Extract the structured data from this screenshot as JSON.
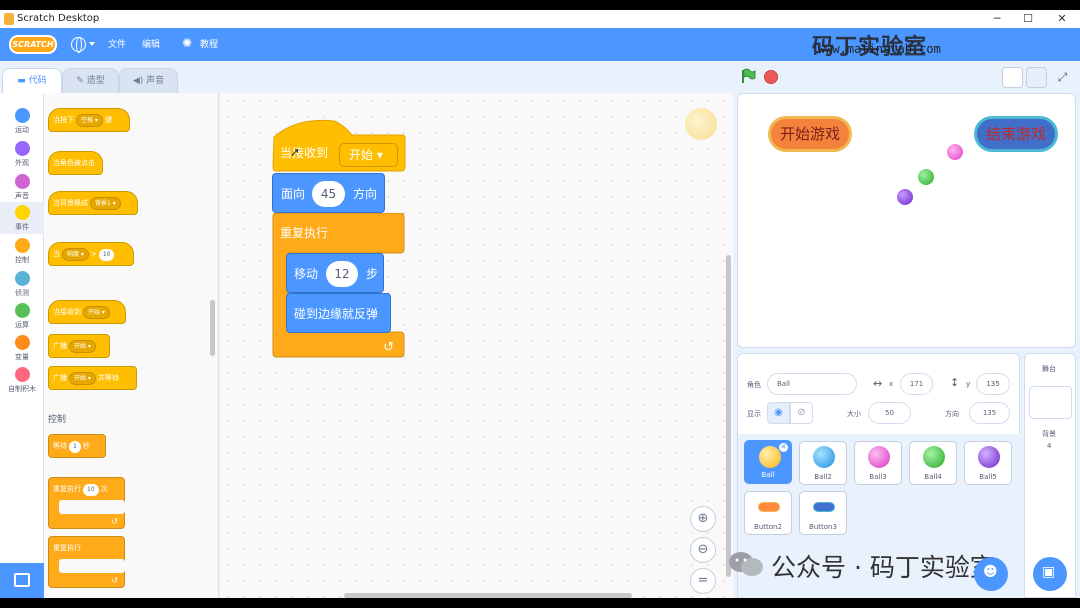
{
  "window": {
    "title": "Scratch Desktop",
    "min": "─",
    "max": "☐",
    "close": "✕"
  },
  "menubar": {
    "logo": "SCRATCH",
    "file": "文件",
    "edit": "编辑",
    "tutorials": "教程"
  },
  "watermark": {
    "title": "码丁实验室",
    "url": "www.matinslab.com",
    "wechat": "公众号 · 码丁实验室"
  },
  "tabs": {
    "code": "代码",
    "costumes": "造型",
    "sounds": "声音"
  },
  "categories": [
    {
      "label": "运动",
      "color": "#4c97ff"
    },
    {
      "label": "外观",
      "color": "#9966ff"
    },
    {
      "label": "声音",
      "color": "#cf63cf"
    },
    {
      "label": "事件",
      "color": "#ffd500"
    },
    {
      "label": "控制",
      "color": "#ffab19"
    },
    {
      "label": "侦测",
      "color": "#5cb1d6"
    },
    {
      "label": "运算",
      "color": "#59c059"
    },
    {
      "label": "变量",
      "color": "#ff8c1a"
    },
    {
      "label": "自制积木",
      "color": "#ff6680"
    }
  ],
  "palette": {
    "when_key": "当按下",
    "key_value": "空格",
    "key_suffix": "键",
    "when_sprite_clicked": "当角色被点击",
    "when_backdrop": "当背景换成",
    "backdrop_value": "背景1",
    "when_gt": "当",
    "loudness": "响度",
    "gt": ">",
    "gt_value": "10",
    "when_receive": "当接收到",
    "receive_value": "开始",
    "broadcast": "广播",
    "broadcast_value": "开始",
    "broadcast_wait": "广播",
    "broadcast_wait_value": "开始",
    "broadcast_wait_suffix": "并等待",
    "control_heading": "控制",
    "wait": "等待",
    "wait_value": "1",
    "wait_suffix": "秒",
    "repeat": "重复执行",
    "repeat_value": "10",
    "repeat_suffix": "次",
    "forever": "重复执行"
  },
  "script": {
    "hat": "当接收到",
    "hat_value": "开始",
    "point": "面向",
    "point_value": "45",
    "point_suffix": "方向",
    "forever": "重复执行",
    "move": "移动",
    "move_value": "12",
    "move_suffix": "步",
    "bounce": "碰到边缘就反弹"
  },
  "stage": {
    "start_button": "开始游戏",
    "end_button": "结束游戏"
  },
  "sprite_info": {
    "sprite_label": "角色",
    "sprite_name": "Ball",
    "x_label": "x",
    "x_value": "171",
    "y_label": "y",
    "y_value": "135",
    "show_label": "显示",
    "size_label": "大小",
    "size_value": "50",
    "direction_label": "方向",
    "direction_value": "135"
  },
  "sprites": [
    {
      "name": "Ball",
      "color": "#ffbf2e",
      "selected": true
    },
    {
      "name": "Ball2",
      "color": "#36a9f7"
    },
    {
      "name": "Ball3",
      "color": "#e94fd0"
    },
    {
      "name": "Ball4",
      "color": "#3cbf3c"
    },
    {
      "name": "Ball5",
      "color": "#8a3fe0"
    },
    {
      "name": "Button2",
      "color": "#ff8a3d"
    },
    {
      "name": "Button3",
      "color": "#4170d0"
    }
  ],
  "stage_pane": {
    "title": "舞台",
    "backdrops_label": "背景",
    "backdrops_count": "4"
  }
}
